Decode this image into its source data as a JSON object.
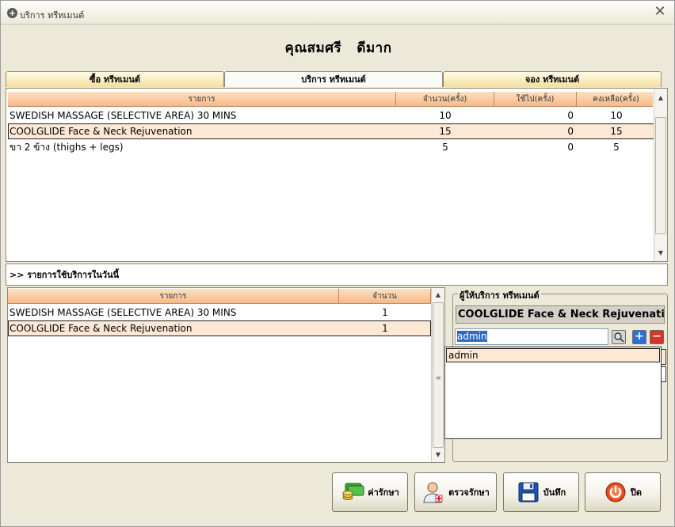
{
  "window": {
    "title": "บริการ ทรีทเมนต์"
  },
  "customer_name": "คุณสมศรี   ดีมาก",
  "tabs": [
    {
      "label": "ซื้อ ทรีทเมนต์",
      "active": false
    },
    {
      "label": "บริการ ทรีทเมนต์",
      "active": true
    },
    {
      "label": "จอง ทรีทเมนต์",
      "active": false
    }
  ],
  "treatments_table": {
    "columns": [
      "รายการ",
      "จำนวน(ครั้ง)",
      "ใช้ไป(ครั้ง)",
      "คงเหลือ(ครั้ง)"
    ],
    "rows": [
      {
        "item": "SWEDISH MASSAGE (SELECTIVE AREA) 30 MINS",
        "total": "10",
        "used": "0",
        "remaining": "10"
      },
      {
        "item": "COOLGLIDE Face & Neck Rejuvenation",
        "total": "15",
        "used": "0",
        "remaining": "15"
      },
      {
        "item": "ขา 2 ข้าง (thighs + legs)",
        "total": "5",
        "used": "0",
        "remaining": "5"
      }
    ],
    "selected_row": 1
  },
  "today_label": ">> รายการใช้บริการในวันนี้",
  "today_table": {
    "columns": [
      "รายการ",
      "จำนวน"
    ],
    "rows": [
      {
        "item": "SWEDISH MASSAGE (SELECTIVE AREA) 30 MINS",
        "qty": "1"
      },
      {
        "item": "COOLGLIDE Face & Neck Rejuvenation",
        "qty": "1"
      }
    ],
    "selected_row": 1
  },
  "provider_group": {
    "legend": "ผู้ให้บริการ ทรีทเมนต์",
    "selected_treatment": "COOLGLIDE Face & Neck Rejuvenation",
    "staff_value": "admin",
    "dropdown_options": [
      "admin"
    ]
  },
  "buttons": {
    "fee": "ค่ารักษา",
    "examine": "ตรวจรักษา",
    "save": "บันทึก",
    "close": "ปิด"
  },
  "colors": {
    "header_gradient_top": "#fde0c2",
    "header_gradient_bottom": "#f6b989",
    "selected_row": "#fde8d5",
    "window_bg": "#ece9d8"
  }
}
